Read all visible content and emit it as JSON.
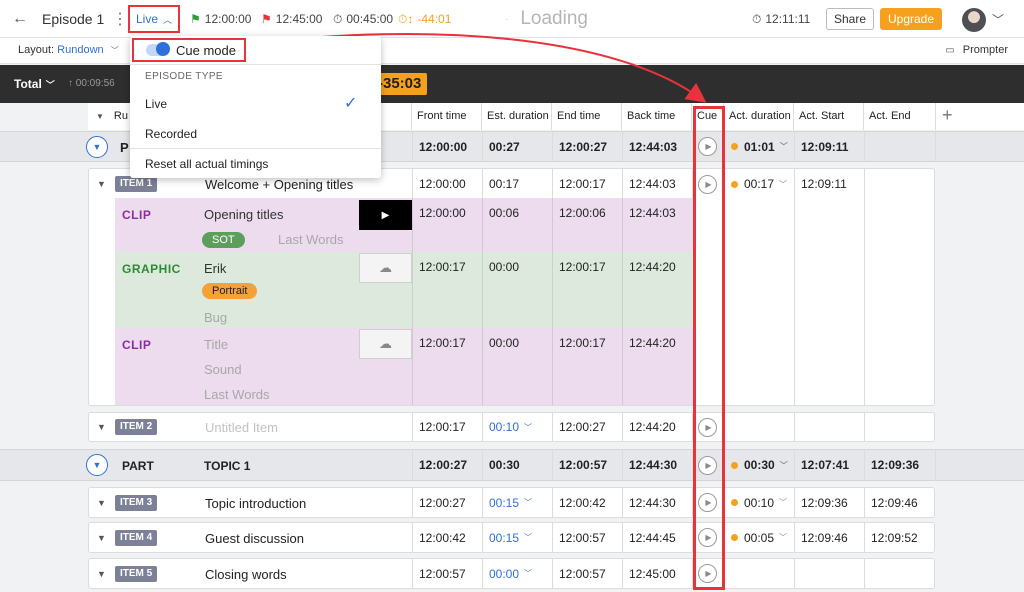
{
  "header": {
    "back_icon": "arrow-left-icon",
    "episode_title": "Episode 1",
    "mode_label": "Live",
    "planned_start": "12:00:00",
    "planned_end": "12:45:00",
    "duration": "00:45:00",
    "over_under": "-44:01",
    "loading_text": "Loading",
    "clock": "12:11:11",
    "share_label": "Share",
    "upgrade_label": "Upgrade",
    "colors": {
      "accent": "#2f6fdb",
      "upgrade": "#f5a11b",
      "highlight": "#e8323c",
      "flag_green": "#2e9b3b",
      "flag_red": "#e8323c",
      "over_under": "#f5a11b"
    }
  },
  "layout_bar": {
    "label": "Layout:",
    "value": "Rundown",
    "prompter_label": "Prompter"
  },
  "total_bar": {
    "label": "Total",
    "time": "00:09:56",
    "over_badge": "-35:03"
  },
  "columns": {
    "rundown": "Ru",
    "front_time": "Front time",
    "est_duration": "Est. duration",
    "end_time": "End time",
    "back_time": "Back time",
    "cue": "Cue",
    "act_duration": "Act. duration",
    "act_start": "Act. Start",
    "act_end": "Act. End"
  },
  "dropdown": {
    "cue_mode_label": "Cue mode",
    "cue_mode_on": true,
    "episode_type_heading": "EPISODE TYPE",
    "options": [
      "Live",
      "Recorded"
    ],
    "selected": "Live",
    "reset_label": "Reset all actual timings"
  },
  "part1": {
    "front": "12:00:00",
    "est": "00:27",
    "end": "12:00:27",
    "back": "12:44:03",
    "act_dur": "01:01",
    "act_start": "12:09:11",
    "act_end": ""
  },
  "item1": {
    "badge": "ITEM 1",
    "title": "Welcome + Opening titles",
    "front": "12:00:00",
    "est": "00:17",
    "end": "12:00:17",
    "back": "12:44:03",
    "act_dur": "00:17",
    "act_start": "12:09:11",
    "act_end": "",
    "elements": [
      {
        "type": "CLIP",
        "field1": "Opening titles",
        "pill": "SOT",
        "field2": "Last Words",
        "front": "12:00:00",
        "est": "00:06",
        "end": "12:00:06",
        "back": "12:44:03"
      },
      {
        "type": "GRAPHIC",
        "field1": "Erik",
        "pill": "Portrait",
        "field2": "Bug",
        "front": "12:00:17",
        "est": "00:00",
        "end": "12:00:17",
        "back": "12:44:20"
      },
      {
        "type": "CLIP",
        "field1": "Title",
        "field2": "Sound",
        "field3": "Last Words",
        "front": "12:00:17",
        "est": "00:00",
        "end": "12:00:17",
        "back": "12:44:20"
      }
    ]
  },
  "item2": {
    "badge": "ITEM 2",
    "title": "Untitled Item",
    "front": "12:00:17",
    "est": "00:10",
    "end": "12:00:27",
    "back": "12:44:20"
  },
  "part2": {
    "badge": "PART",
    "title": "TOPIC 1",
    "front": "12:00:27",
    "est": "00:30",
    "end": "12:00:57",
    "back": "12:44:30",
    "act_dur": "00:30",
    "act_start": "12:07:41",
    "act_end": "12:09:36"
  },
  "item3": {
    "badge": "ITEM 3",
    "title": "Topic introduction",
    "front": "12:00:27",
    "est": "00:15",
    "end": "12:00:42",
    "back": "12:44:30",
    "act_dur": "00:10",
    "act_start": "12:09:36",
    "act_end": "12:09:46"
  },
  "item4": {
    "badge": "ITEM 4",
    "title": "Guest discussion",
    "front": "12:00:42",
    "est": "00:15",
    "end": "12:00:57",
    "back": "12:44:45",
    "act_dur": "00:05",
    "act_start": "12:09:46",
    "act_end": "12:09:52"
  },
  "item5": {
    "badge": "ITEM 5",
    "title": "Closing words",
    "front": "12:00:57",
    "est": "00:00",
    "end": "12:00:57",
    "back": "12:45:00"
  }
}
